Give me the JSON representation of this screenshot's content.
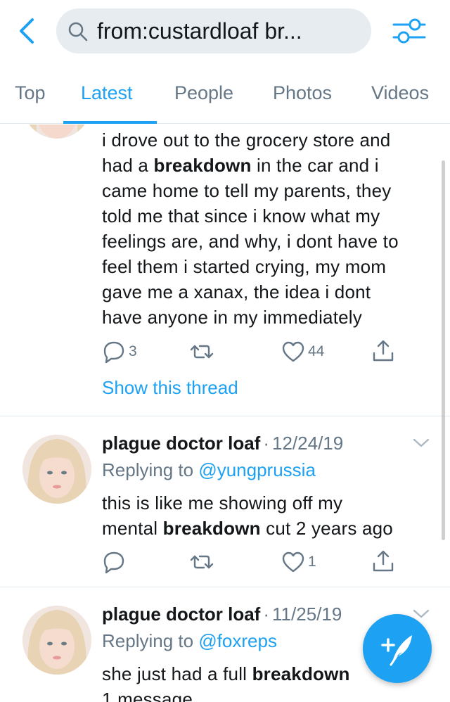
{
  "search": {
    "query": "from:custardloaf br..."
  },
  "tabs": [
    {
      "label": "Top",
      "active": false
    },
    {
      "label": "Latest",
      "active": true
    },
    {
      "label": "People",
      "active": false
    },
    {
      "label": "Photos",
      "active": false
    },
    {
      "label": "Videos",
      "active": false
    }
  ],
  "tweets": [
    {
      "lines": [
        {
          "before": "i drove out to the grocery store and",
          "bold": "",
          "after": ""
        },
        {
          "before": "had a ",
          "bold": "breakdown",
          "after": " in the car and i"
        },
        {
          "before": "came home to tell my parents, they",
          "bold": "",
          "after": ""
        },
        {
          "before": "told me that since i know what my",
          "bold": "",
          "after": ""
        },
        {
          "before": "feelings are, and why, i dont have to",
          "bold": "",
          "after": ""
        },
        {
          "before": "feel them i started crying, my mom",
          "bold": "",
          "after": ""
        },
        {
          "before": "gave me a xanax, the idea i dont",
          "bold": "",
          "after": ""
        },
        {
          "before": "have anyone in my immediately",
          "bold": "",
          "after": ""
        }
      ],
      "replies": "3",
      "retweets": "",
      "likes": "44",
      "show_thread": "Show this thread"
    },
    {
      "name": "plague doctor loaf",
      "separator": "·",
      "date": "12/24/19",
      "replying_prefix": "Replying to ",
      "replying_handle": "@yungprussia",
      "lines": [
        {
          "before": "this is like me showing off my",
          "bold": "",
          "after": ""
        },
        {
          "before": "mental ",
          "bold": "breakdown",
          "after": " cut 2 years ago"
        }
      ],
      "replies": "",
      "retweets": "",
      "likes": "1"
    },
    {
      "name": "plague doctor loaf",
      "separator": "·",
      "date": "11/25/19",
      "replying_prefix": "Replying to ",
      "replying_handle": "@foxreps",
      "lines": [
        {
          "before": "she just had a full ",
          "bold": "breakdown",
          "after": ""
        },
        {
          "before": "1 message",
          "bold": "",
          "after": ""
        }
      ]
    }
  ],
  "icons": {
    "back": "chevron-left-icon",
    "search": "search-icon",
    "filter": "sliders-icon",
    "reply": "comment-icon",
    "retweet": "retweet-icon",
    "like": "heart-icon",
    "share": "share-icon",
    "compose": "compose-tweet-icon"
  },
  "colors": {
    "accent": "#1da1f2",
    "secondary_text": "#657786",
    "search_bg": "#e6ecf0"
  }
}
